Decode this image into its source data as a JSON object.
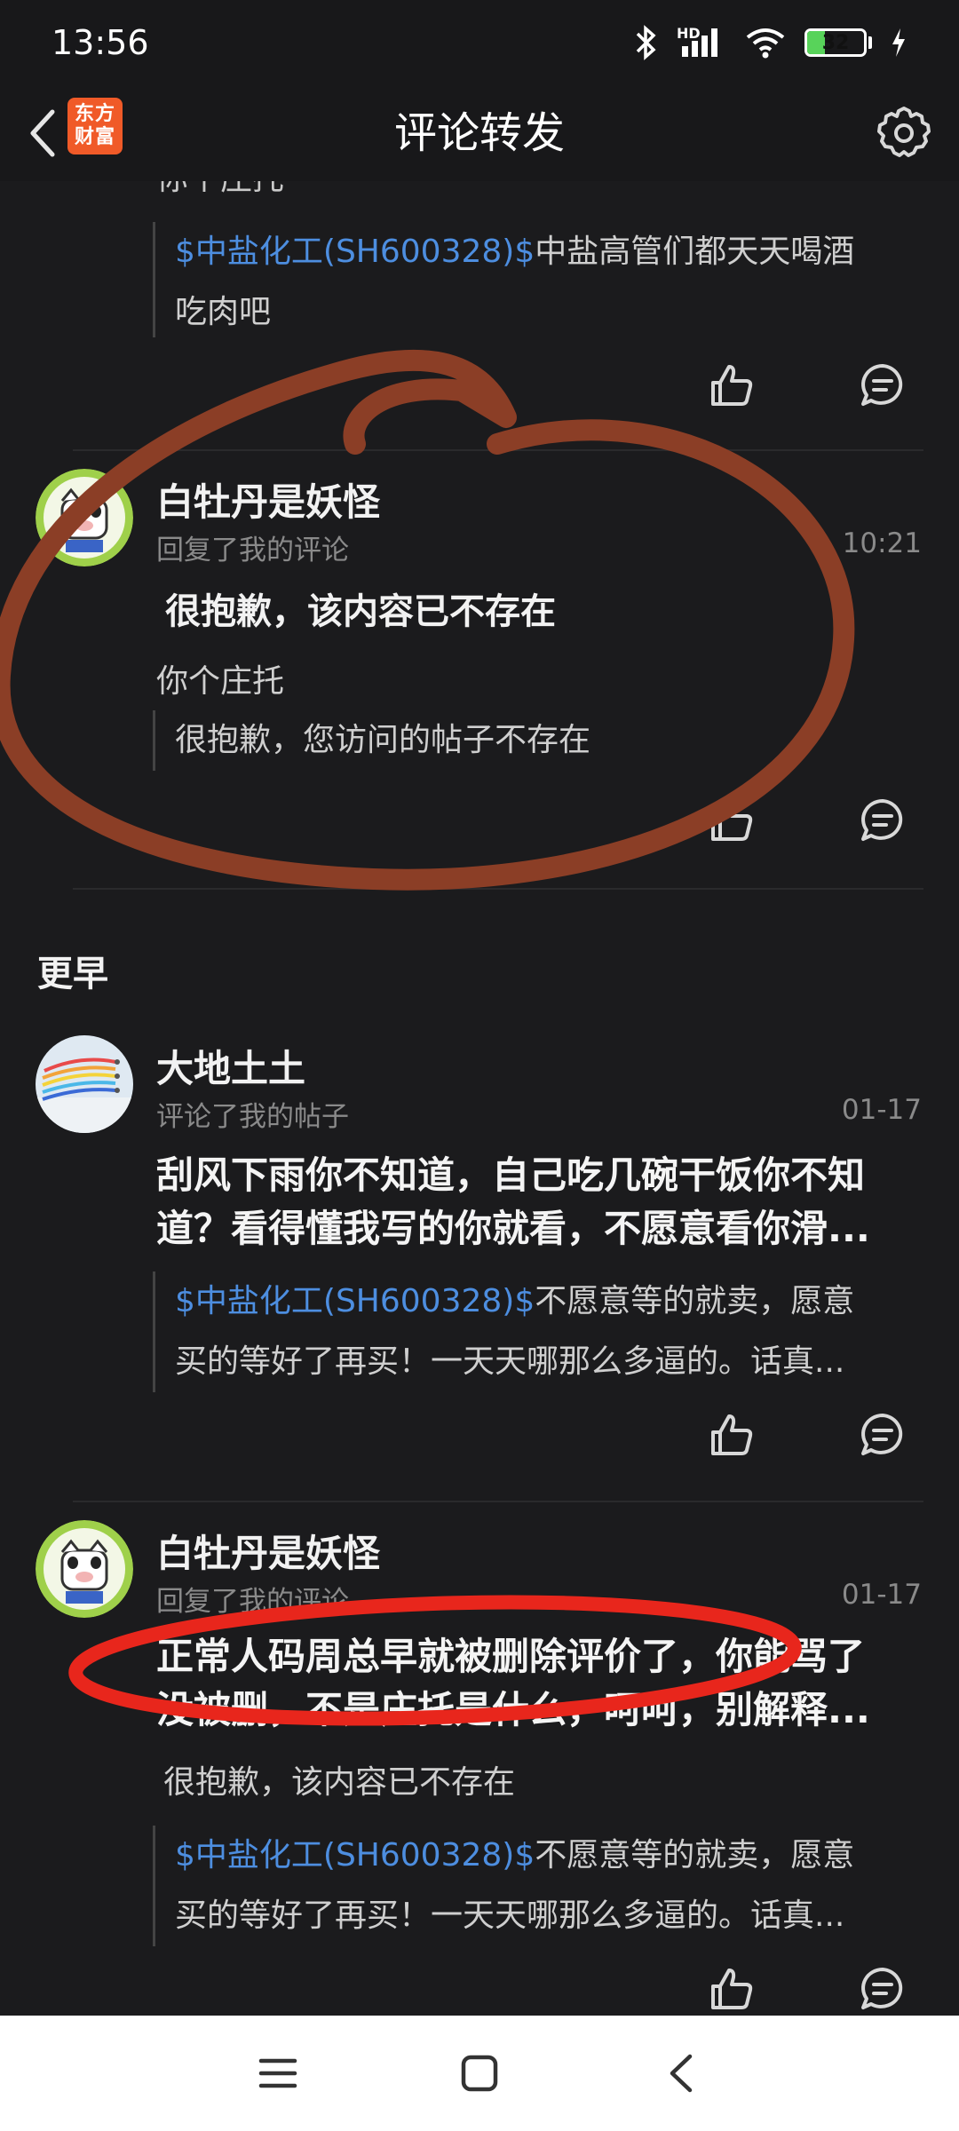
{
  "status_bar": {
    "time": "13:56",
    "network_label": "HD",
    "battery": "32"
  },
  "app_bar": {
    "logo_line1": "东方",
    "logo_line2": "财富",
    "title": "评论转发"
  },
  "top_partial": {
    "truncated_text": "你个庄托",
    "quote_tag": "$中盐化工(SH600328)$",
    "quote_text": "中盐高管们都天天喝酒",
    "quote_text2": "吃肉吧"
  },
  "items": [
    {
      "user": "白牡丹是妖怪",
      "action": "回复了我的评论",
      "time": "10:21",
      "deleted_notice": "很抱歉，该内容已不存在",
      "reply": "你个庄托",
      "quote_text": "很抱歉，您访问的帖子不存在"
    },
    {
      "user": "大地土土",
      "action": "评论了我的帖子",
      "time": "01-17",
      "body_line1": "刮风下雨你不知道，自己吃几碗干饭你不知",
      "body_line2": "道？看得懂我写的你就看，不愿意看你滑...",
      "quote_tag": "$中盐化工(SH600328)$",
      "quote_line1": "不愿意等的就卖，愿意",
      "quote_line2": "买的等好了再买！一天天哪那么多逼的。话真..."
    },
    {
      "user": "白牡丹是妖怪",
      "action": "回复了我的评论",
      "time": "01-17",
      "body_line1": "正常人码周总早就被删除评价了，你能骂了",
      "body_line2": "没被删，不是庄托是什么，呵呵，别解释...",
      "deleted_notice": "很抱歉，该内容已不存在",
      "quote_tag": "$中盐化工(SH600328)$",
      "quote_line1": "不愿意等的就卖，愿意",
      "quote_line2": "买的等好了再买！一天天哪那么多逼的。话真..."
    }
  ],
  "section": {
    "earlier_label": "更早"
  },
  "icons": {
    "like": "thumbs-up-icon",
    "comment": "comment-bubble-icon",
    "settings": "gear-icon",
    "back": "chevron-left-icon"
  },
  "colors": {
    "background": "#1b1b1d",
    "accent_link": "#4d8ee0",
    "logo": "#f05a28",
    "annotation_brown": "#8b3e26",
    "annotation_red": "#e8261c"
  }
}
